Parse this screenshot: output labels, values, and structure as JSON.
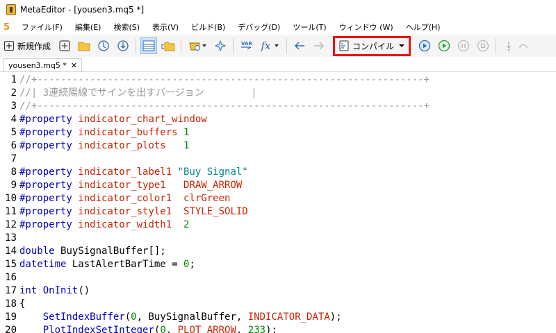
{
  "window": {
    "title": "MetaEditor - [yousen3.mq5 *]"
  },
  "menu": {
    "logo": "5",
    "items": [
      "ファイル(F)",
      "編集(E)",
      "検索(S)",
      "表示(V)",
      "ビルド(B)",
      "デバッグ(D)",
      "ツール(T)",
      "ウィンドウ (W)",
      "ヘルプ(H)"
    ]
  },
  "toolbar": {
    "new_label": "新規作成",
    "compile_label": "コンパイル",
    "var_label": "VAR",
    "fx_label": "fx"
  },
  "tab": {
    "label": "yousen3.mq5 *",
    "close": "✕"
  },
  "code": {
    "l1": {
      "n": "1",
      "t": "//+------------------------------------------------------------------+"
    },
    "l2": {
      "n": "2",
      "t": "//| 3連続陽線でサインを出すバージョン        |"
    },
    "l3": {
      "n": "3",
      "t": "//+------------------------------------------------------------------+"
    },
    "l4": {
      "n": "4",
      "kw": "#property",
      "p": "indicator_chart_window"
    },
    "l5": {
      "n": "5",
      "kw": "#property",
      "p": "indicator_buffers",
      "v": "1"
    },
    "l6": {
      "n": "6",
      "kw": "#property",
      "p": "indicator_plots",
      "v": "1"
    },
    "l7": {
      "n": "7"
    },
    "l8": {
      "n": "8",
      "kw": "#property",
      "p": "indicator_label1",
      "s": "\"Buy Signal\""
    },
    "l9": {
      "n": "9",
      "kw": "#property",
      "p": "indicator_type1",
      "c": "DRAW_ARROW"
    },
    "l10": {
      "n": "10",
      "kw": "#property",
      "p": "indicator_color1",
      "c": "clrGreen"
    },
    "l11": {
      "n": "11",
      "kw": "#property",
      "p": "indicator_style1",
      "c": "STYLE_SOLID"
    },
    "l12": {
      "n": "12",
      "kw": "#property",
      "p": "indicator_width1",
      "v": "2"
    },
    "l13": {
      "n": "13"
    },
    "l14": {
      "n": "14",
      "kw": "double",
      "rest": "BuySignalBuffer[];"
    },
    "l15": {
      "n": "15",
      "kw": "datetime",
      "rest": "LastAlertBarTime = ",
      "v": "0",
      "end": ";"
    },
    "l16": {
      "n": "16"
    },
    "l17": {
      "n": "17",
      "kw": "int",
      "fn": "OnInit",
      "rest": "()"
    },
    "l18": {
      "n": "18",
      "rest": "{"
    },
    "l19": {
      "n": "19",
      "fn": "SetIndexBuffer",
      "a1": "(",
      "v": "0",
      "a2": ", BuySignalBuffer, ",
      "c": "INDICATOR_DATA",
      "end": ");"
    },
    "l20": {
      "n": "20",
      "fn": "PlotIndexSetInteger",
      "a1": "(",
      "v": "0",
      "a2": ", ",
      "c": "PLOT_ARROW",
      "a3": ", ",
      "v2": "233",
      "end": ");"
    }
  }
}
